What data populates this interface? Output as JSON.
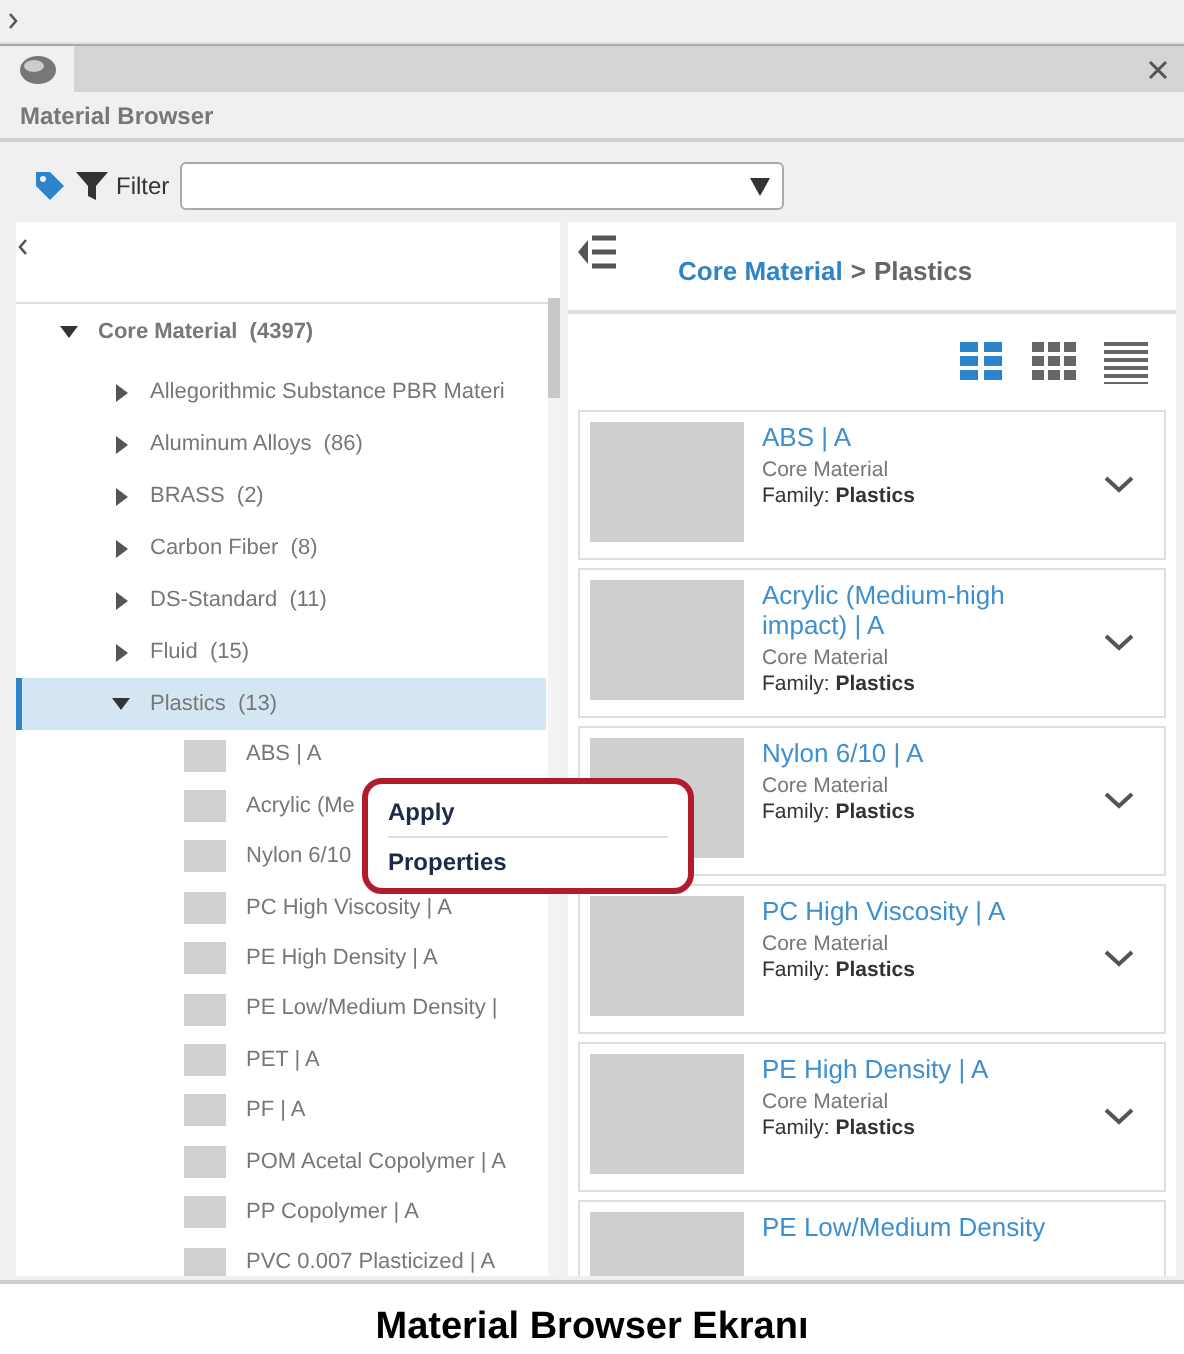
{
  "window": {
    "title": "Material Browser"
  },
  "filter": {
    "label": "Filter"
  },
  "tree": {
    "items": [
      {
        "label": "Core Material",
        "count": "(4397)",
        "expanded": true,
        "selected": false,
        "children": [
          {
            "kind": "folder",
            "label": "Allegorithmic Substance PBR Materi",
            "expanded": false,
            "selected": false
          },
          {
            "kind": "folder",
            "label": "Aluminum Alloys",
            "count": "(86)",
            "expanded": false,
            "selected": false
          },
          {
            "kind": "folder",
            "label": "BRASS",
            "count": "(2)",
            "expanded": false,
            "selected": false
          },
          {
            "kind": "folder",
            "label": "Carbon Fiber",
            "count": "(8)",
            "expanded": false,
            "selected": false
          },
          {
            "kind": "folder",
            "label": "DS-Standard",
            "count": "(11)",
            "expanded": false,
            "selected": false
          },
          {
            "kind": "folder",
            "label": "Fluid",
            "count": "(15)",
            "expanded": false,
            "selected": false
          },
          {
            "kind": "folder",
            "label": "Plastics",
            "count": "(13)",
            "expanded": true,
            "selected": true,
            "children": [
              {
                "kind": "material",
                "label": "ABS | A"
              },
              {
                "kind": "material",
                "label": "Acrylic (Me"
              },
              {
                "kind": "material",
                "label": "Nylon 6/10"
              },
              {
                "kind": "material",
                "label": "PC High Viscosity | A"
              },
              {
                "kind": "material",
                "label": "PE High Density | A"
              },
              {
                "kind": "material",
                "label": "PE Low/Medium Density |"
              },
              {
                "kind": "material",
                "label": "PET | A"
              },
              {
                "kind": "material",
                "label": "PF | A"
              },
              {
                "kind": "material",
                "label": "POM Acetal Copolymer | A"
              },
              {
                "kind": "material",
                "label": "PP Copolymer | A"
              },
              {
                "kind": "material",
                "label": "PVC 0.007 Plasticized | A"
              }
            ]
          }
        ]
      }
    ]
  },
  "context_menu": {
    "items": [
      "Apply",
      "Properties"
    ]
  },
  "breadcrumb": {
    "root": "Core Material",
    "separator": ">",
    "current": "Plastics"
  },
  "view_modes": [
    {
      "kind": "cards",
      "selected": true
    },
    {
      "kind": "grid",
      "selected": false
    },
    {
      "kind": "list",
      "selected": false
    }
  ],
  "cards": [
    {
      "title": "ABS | A",
      "source": "Core Material",
      "family": "Family: **Plastics**"
    },
    {
      "title": "Acrylic (Medium-high impact) | A",
      "source": "Core Material",
      "family": "Family: **Plastics**"
    },
    {
      "title": "Nylon 6/10 | A",
      "source": "Core Material",
      "family": "Family: **Plastics**"
    },
    {
      "title": "PC High Viscosity | A",
      "source": "Core Material",
      "family": "Family: **Plastics**"
    },
    {
      "title": "PE High Density | A",
      "source": "Core Material",
      "family": "Family: **Plastics**"
    },
    {
      "title": "PE Low/Medium Density"
    }
  ],
  "caption": "Material Browser Ekranı"
}
